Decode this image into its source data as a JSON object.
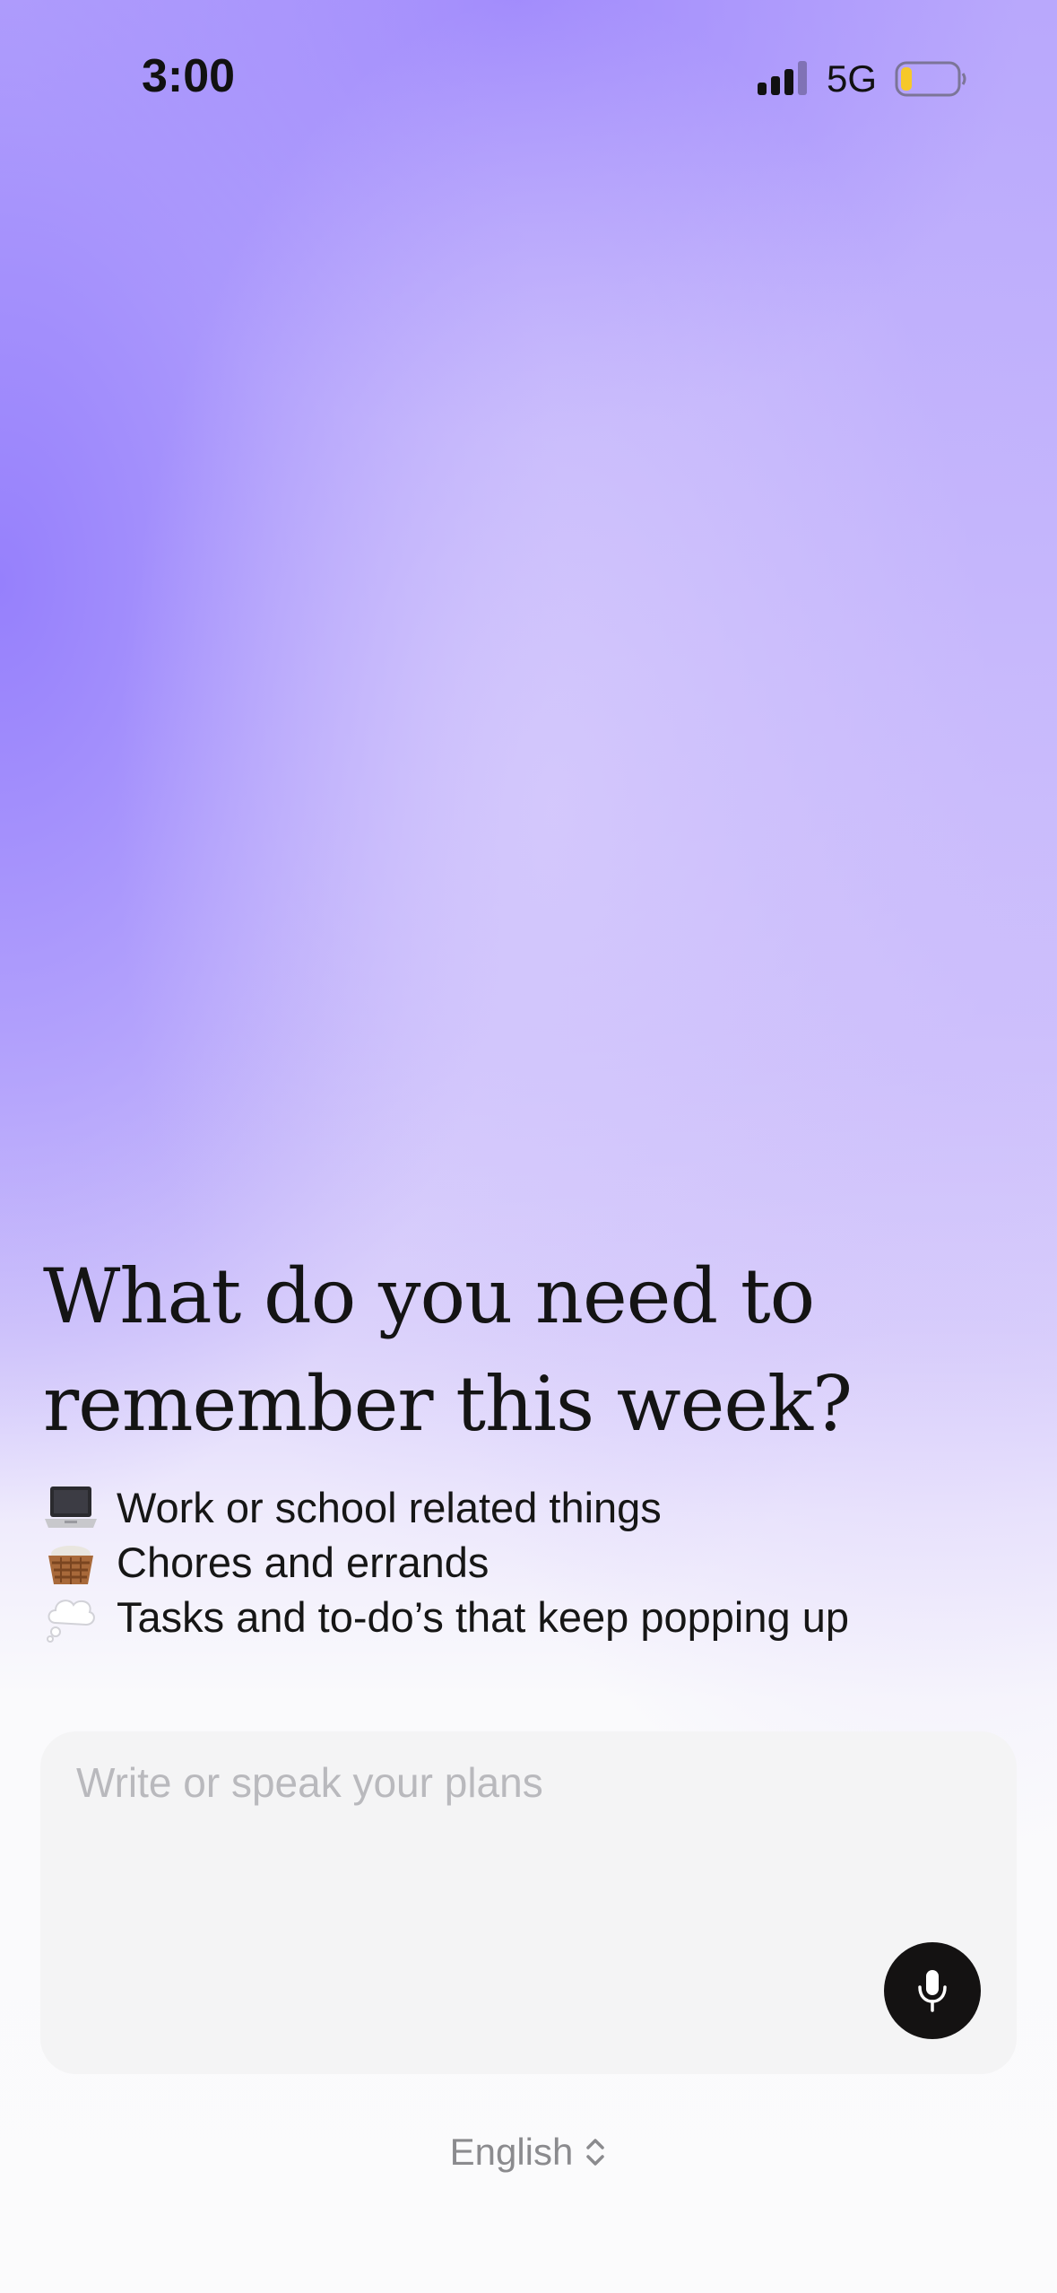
{
  "status_bar": {
    "time": "3:00",
    "network": "5G",
    "battery_color": "#f6c829"
  },
  "prompt": {
    "line1": "What do you need to",
    "line2": "remember this week?"
  },
  "suggestions": [
    {
      "icon": "laptop-icon",
      "label": "Work or school related things"
    },
    {
      "icon": "basket-icon",
      "label": "Chores and errands"
    },
    {
      "icon": "thought-bubble-icon",
      "label": "Tasks and to-do’s that keep popping up"
    }
  ],
  "input": {
    "placeholder": "Write or speak your plans",
    "value": ""
  },
  "language": {
    "label": "English"
  },
  "colors": {
    "accent_purple": "#9f8bfc",
    "mic_button": "#141212"
  }
}
